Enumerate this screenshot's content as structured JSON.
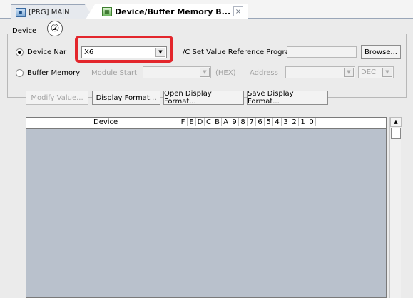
{
  "tabs": [
    {
      "label": "[PRG] MAIN",
      "icon": "program-icon"
    },
    {
      "label": "Device/Buffer Memory B...",
      "icon": "device-monitor-icon",
      "close": "×"
    }
  ],
  "group": {
    "label": "Device",
    "marker": "②"
  },
  "device_name": {
    "label": "Device Nar",
    "value": "X6",
    "selected": true
  },
  "buffer_memory": {
    "label": "Buffer Memory",
    "module_start_label": "Module Start",
    "hex_label": "(HEX)",
    "address_label": "Address",
    "dec_value": "DEC"
  },
  "tc_label": "/C Set Value Reference Program",
  "browse_label": "Browse...",
  "buttons": {
    "modify_value": "Modify Value...",
    "display_format": "Display Format...",
    "open_display_format": "Open Display Format...",
    "save_display_format": "Save Display Format..."
  },
  "grid": {
    "col_device": "Device",
    "bits": [
      "F",
      "E",
      "D",
      "C",
      "B",
      "A",
      "9",
      "8",
      "7",
      "6",
      "5",
      "4",
      "3",
      "2",
      "1",
      "0"
    ]
  },
  "colors": {
    "highlight": "#e3262c",
    "grid_body": "#b9c1cc"
  }
}
